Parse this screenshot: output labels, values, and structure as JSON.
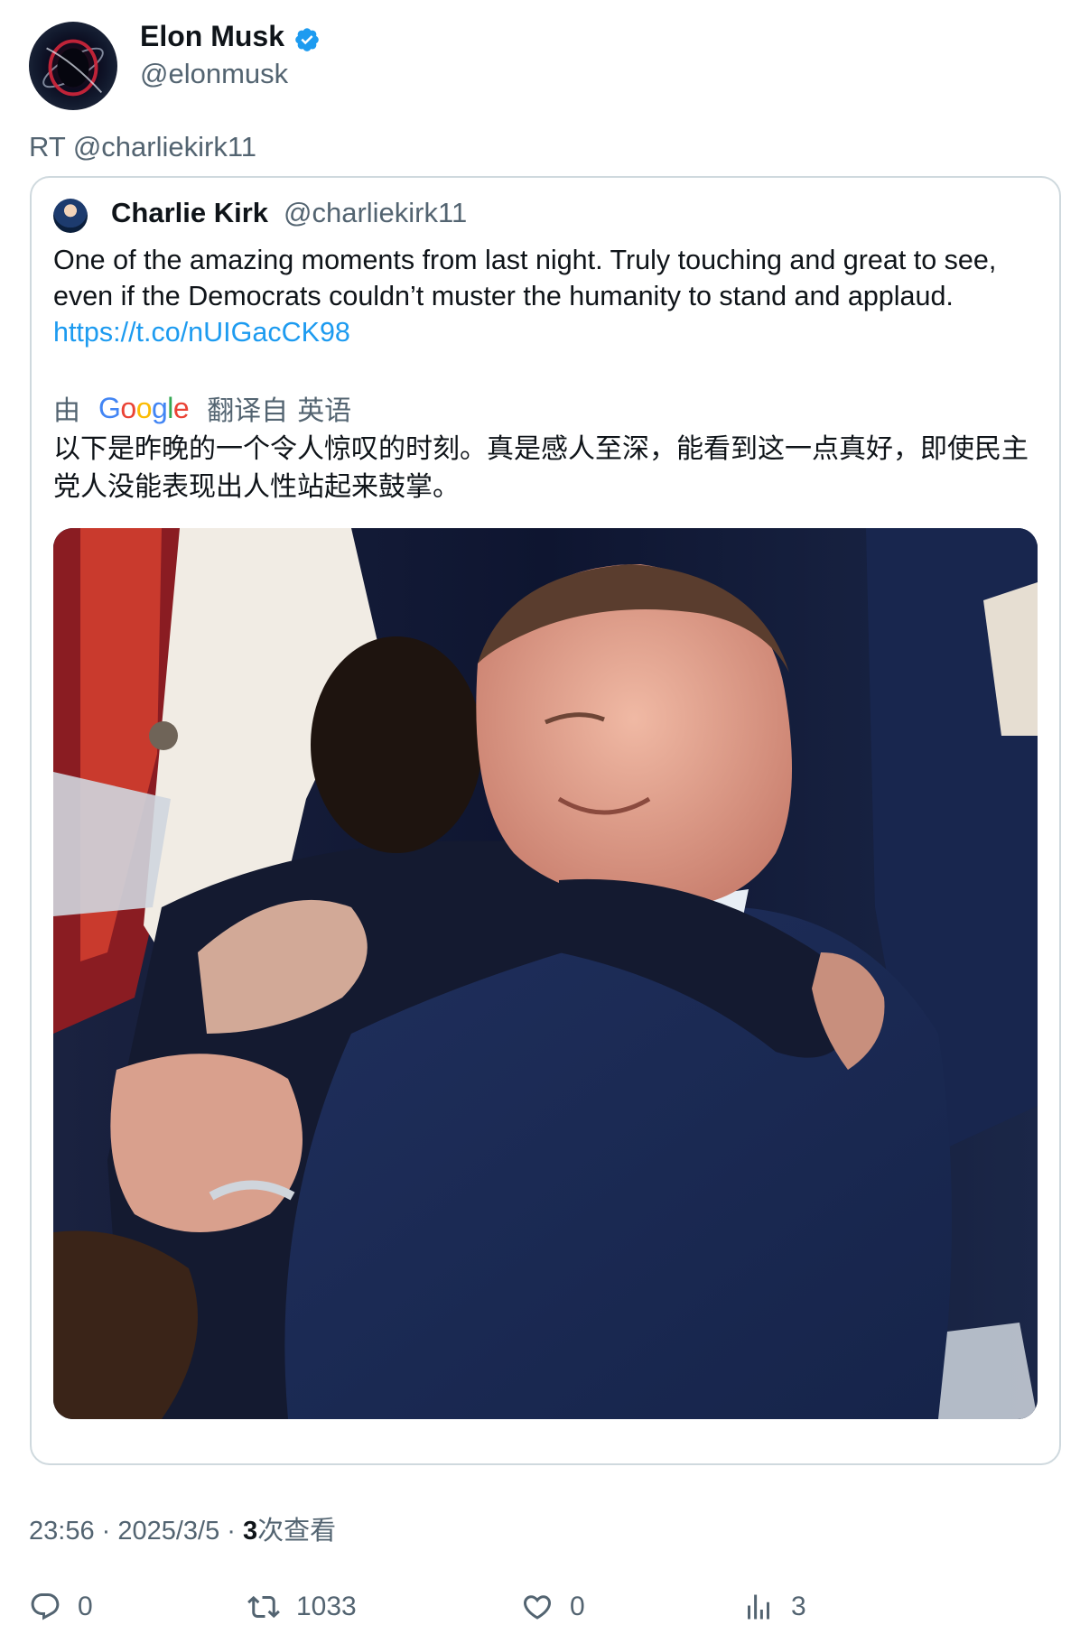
{
  "author": {
    "name": "Elon Musk",
    "handle": "@elonmusk",
    "verified_color": "#1d9bf0"
  },
  "retweet_label": "RT @charliekirk11",
  "quoted": {
    "name": "Charlie Kirk",
    "handle": "@charliekirk11",
    "text": "One of the amazing moments from last night. Truly touching and great to see, even if the Democrats couldn’t muster the humanity to stand and applaud. ",
    "link": "https://t.co/nUIGacCK98"
  },
  "translation": {
    "by_label": "由",
    "provider_letters": [
      "G",
      "o",
      "o",
      "g",
      "l",
      "e"
    ],
    "from_label": "翻译自",
    "language": "英语",
    "text": "以下是昨晚的一个令人惊叹的时刻。真是感人至深，能看到这一点真好，即使民主党人没能表现出人性站起来鼓掌。"
  },
  "meta": {
    "time": "23:56",
    "sep1": " · ",
    "date": "2025/3/5",
    "sep2": " · ",
    "views": "3",
    "views_label": "次查看"
  },
  "actions": {
    "reply_count": "0",
    "retweet_count": "1033",
    "like_count": "0",
    "views_count": "3"
  },
  "icons": {
    "reply": "reply-icon",
    "retweet": "retweet-icon",
    "like": "heart-icon",
    "views": "analytics-icon",
    "verified": "verified-badge-icon"
  }
}
